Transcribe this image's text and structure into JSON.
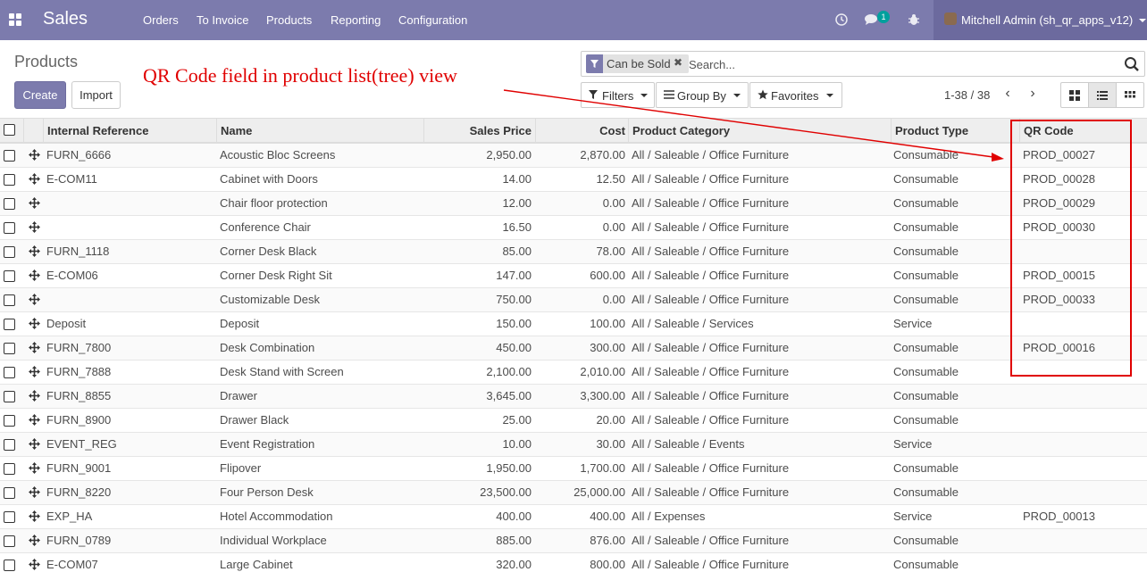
{
  "navbar": {
    "brand": "Sales",
    "menu": [
      "Orders",
      "To Invoice",
      "Products",
      "Reporting",
      "Configuration"
    ],
    "messages_badge": "1",
    "user": "Mitchell Admin (sh_qr_apps_v12)",
    "background_color": "#7c7bad"
  },
  "control_panel": {
    "title": "Products",
    "create_label": "Create",
    "import_label": "Import",
    "search": {
      "facet": "Can be Sold",
      "placeholder": "Search..."
    },
    "filters_label": "Filters",
    "groupby_label": "Group By",
    "favorites_label": "Favorites",
    "pager": "1-38 / 38",
    "views": [
      "kanban-view-icon",
      "list-view-icon",
      "grid-view-icon"
    ],
    "active_view": "list"
  },
  "annotation": {
    "text": "QR Code field in product list(tree) view",
    "color": "#e00000"
  },
  "table": {
    "headers": {
      "internal_reference": "Internal Reference",
      "name": "Name",
      "sales_price": "Sales Price",
      "cost": "Cost",
      "product_category": "Product Category",
      "product_type": "Product Type",
      "qr_code": "QR Code"
    },
    "rows": [
      {
        "ref": "FURN_6666",
        "name": "Acoustic Bloc Screens",
        "price": "2,950.00",
        "cost": "2,870.00",
        "category": "All / Saleable / Office Furniture",
        "type": "Consumable",
        "qr": "PROD_00027"
      },
      {
        "ref": "E-COM11",
        "name": "Cabinet with Doors",
        "price": "14.00",
        "cost": "12.50",
        "category": "All / Saleable / Office Furniture",
        "type": "Consumable",
        "qr": "PROD_00028"
      },
      {
        "ref": "",
        "name": "Chair floor protection",
        "price": "12.00",
        "cost": "0.00",
        "category": "All / Saleable / Office Furniture",
        "type": "Consumable",
        "qr": "PROD_00029"
      },
      {
        "ref": "",
        "name": "Conference Chair",
        "price": "16.50",
        "cost": "0.00",
        "category": "All / Saleable / Office Furniture",
        "type": "Consumable",
        "qr": "PROD_00030"
      },
      {
        "ref": "FURN_1118",
        "name": "Corner Desk Black",
        "price": "85.00",
        "cost": "78.00",
        "category": "All / Saleable / Office Furniture",
        "type": "Consumable",
        "qr": ""
      },
      {
        "ref": "E-COM06",
        "name": "Corner Desk Right Sit",
        "price": "147.00",
        "cost": "600.00",
        "category": "All / Saleable / Office Furniture",
        "type": "Consumable",
        "qr": "PROD_00015"
      },
      {
        "ref": "",
        "name": "Customizable Desk",
        "price": "750.00",
        "cost": "0.00",
        "category": "All / Saleable / Office Furniture",
        "type": "Consumable",
        "qr": "PROD_00033"
      },
      {
        "ref": "Deposit",
        "name": "Deposit",
        "price": "150.00",
        "cost": "100.00",
        "category": "All / Saleable / Services",
        "type": "Service",
        "qr": ""
      },
      {
        "ref": "FURN_7800",
        "name": "Desk Combination",
        "price": "450.00",
        "cost": "300.00",
        "category": "All / Saleable / Office Furniture",
        "type": "Consumable",
        "qr": "PROD_00016"
      },
      {
        "ref": "FURN_7888",
        "name": "Desk Stand with Screen",
        "price": "2,100.00",
        "cost": "2,010.00",
        "category": "All / Saleable / Office Furniture",
        "type": "Consumable",
        "qr": ""
      },
      {
        "ref": "FURN_8855",
        "name": "Drawer",
        "price": "3,645.00",
        "cost": "3,300.00",
        "category": "All / Saleable / Office Furniture",
        "type": "Consumable",
        "qr": ""
      },
      {
        "ref": "FURN_8900",
        "name": "Drawer Black",
        "price": "25.00",
        "cost": "20.00",
        "category": "All / Saleable / Office Furniture",
        "type": "Consumable",
        "qr": ""
      },
      {
        "ref": "EVENT_REG",
        "name": "Event Registration",
        "price": "10.00",
        "cost": "30.00",
        "category": "All / Saleable / Events",
        "type": "Service",
        "qr": ""
      },
      {
        "ref": "FURN_9001",
        "name": "Flipover",
        "price": "1,950.00",
        "cost": "1,700.00",
        "category": "All / Saleable / Office Furniture",
        "type": "Consumable",
        "qr": ""
      },
      {
        "ref": "FURN_8220",
        "name": "Four Person Desk",
        "price": "23,500.00",
        "cost": "25,000.00",
        "category": "All / Saleable / Office Furniture",
        "type": "Consumable",
        "qr": ""
      },
      {
        "ref": "EXP_HA",
        "name": "Hotel Accommodation",
        "price": "400.00",
        "cost": "400.00",
        "category": "All / Expenses",
        "type": "Service",
        "qr": "PROD_00013"
      },
      {
        "ref": "FURN_0789",
        "name": "Individual Workplace",
        "price": "885.00",
        "cost": "876.00",
        "category": "All / Saleable / Office Furniture",
        "type": "Consumable",
        "qr": ""
      },
      {
        "ref": "E-COM07",
        "name": "Large Cabinet",
        "price": "320.00",
        "cost": "800.00",
        "category": "All / Saleable / Office Furniture",
        "type": "Consumable",
        "qr": ""
      }
    ]
  }
}
